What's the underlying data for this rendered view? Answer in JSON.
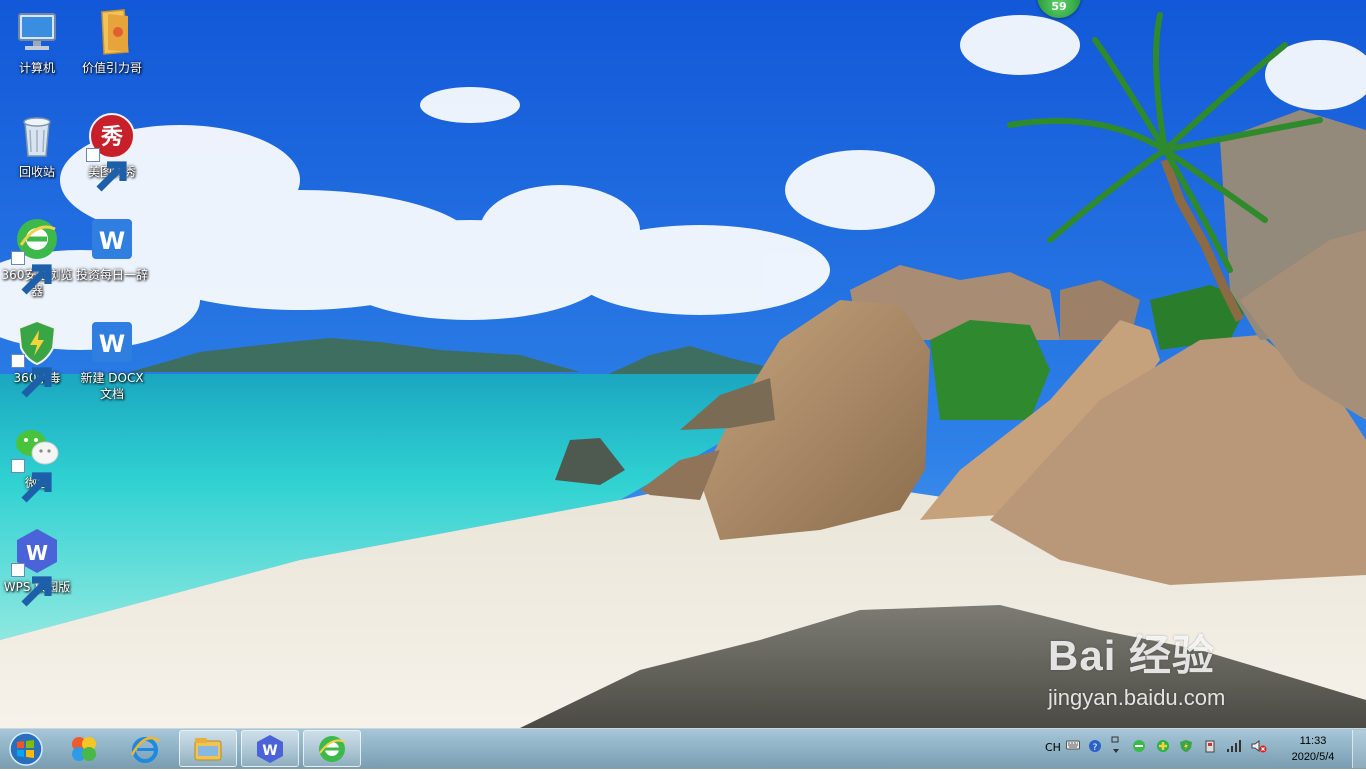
{
  "desktop": {
    "icons": [
      {
        "label": "计算机",
        "icon": "computer-icon",
        "shortcut": false
      },
      {
        "label": "价值引力哥",
        "icon": "folder-icon",
        "shortcut": false
      },
      {
        "label": "回收站",
        "icon": "recycle-bin-icon",
        "shortcut": false
      },
      {
        "label": "美图秀秀",
        "icon": "meitu-icon",
        "shortcut": true
      },
      {
        "label": "360安全浏览器",
        "icon": "360-browser-icon",
        "shortcut": true
      },
      {
        "label": "投资每日一辞",
        "icon": "wps-writer-icon",
        "shortcut": false
      },
      {
        "label": "360杀毒",
        "icon": "360-antivirus-icon",
        "shortcut": true
      },
      {
        "label": "新建 DOCX 文档",
        "icon": "wps-writer-icon",
        "shortcut": false
      },
      {
        "label": "微信",
        "icon": "wechat-icon",
        "shortcut": true
      },
      {
        "label": "WPS 校园版",
        "icon": "wps-campus-icon",
        "shortcut": true
      }
    ],
    "badge": "59"
  },
  "watermark": {
    "main": "Bai  经验",
    "url": "jingyan.baidu.com"
  },
  "taskbar": {
    "start": "windows-start-icon",
    "pinned": [
      "start-orb",
      "360-app-store-icon",
      "internet-explorer-icon",
      "file-explorer-icon",
      "wps-icon",
      "360-browser-icon"
    ],
    "tray": {
      "lang": "CH",
      "icons": [
        "keyboard-icon",
        "help-icon",
        "arrow-up-icon",
        "360-browser-tray-icon",
        "360-plus-icon",
        "shield-icon",
        "device-icon",
        "signal-icon",
        "volume-muted-icon"
      ]
    },
    "time": "11:33",
    "date": "2020/5/4"
  },
  "colors": {
    "sky": "#1a73e8",
    "sea": "#3fd4d0",
    "sand": "#f1ece1",
    "taskbar": "#8fb4c4"
  }
}
